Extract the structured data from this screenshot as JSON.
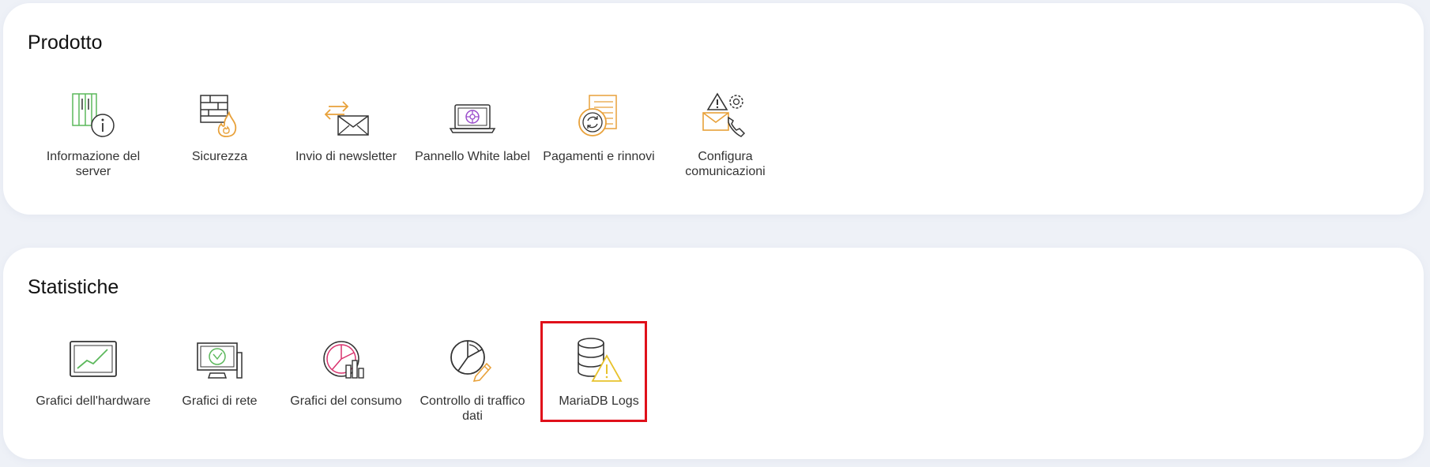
{
  "sections": [
    {
      "title": "Prodotto",
      "items": [
        {
          "label": "Informazione del server",
          "icon": "server-info-icon"
        },
        {
          "label": "Sicurezza",
          "icon": "firewall-icon"
        },
        {
          "label": "Invio di newsletter",
          "icon": "newsletter-icon"
        },
        {
          "label": "Pannello White label",
          "icon": "white-label-laptop-icon"
        },
        {
          "label": "Pagamenti e rinnovi",
          "icon": "payments-renewal-icon"
        },
        {
          "label": "Configura comunicazioni",
          "icon": "communications-settings-icon"
        }
      ]
    },
    {
      "title": "Statistiche",
      "items": [
        {
          "label": "Grafici dell'hardware",
          "icon": "hardware-chart-icon"
        },
        {
          "label": "Grafici di rete",
          "icon": "network-chart-icon"
        },
        {
          "label": "Grafici del consumo",
          "icon": "consumption-chart-icon"
        },
        {
          "label": "Controllo di traffico dati",
          "icon": "traffic-control-icon"
        },
        {
          "label": "MariaDB Logs",
          "icon": "database-warning-icon"
        }
      ]
    }
  ],
  "colors": {
    "green": "#5cb85c",
    "orange": "#e8a13a",
    "purple": "#9b4dcc",
    "pink": "#d9336e",
    "yellow": "#e8c22c",
    "highlight": "#e0101a"
  }
}
